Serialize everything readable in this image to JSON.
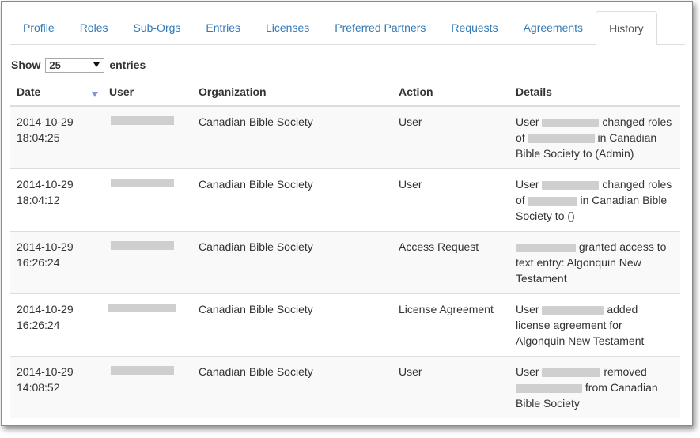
{
  "tabs": [
    {
      "label": "Profile",
      "active": false
    },
    {
      "label": "Roles",
      "active": false
    },
    {
      "label": "Sub-Orgs",
      "active": false
    },
    {
      "label": "Entries",
      "active": false
    },
    {
      "label": "Licenses",
      "active": false
    },
    {
      "label": "Preferred Partners",
      "active": false
    },
    {
      "label": "Requests",
      "active": false
    },
    {
      "label": "Agreements",
      "active": false
    },
    {
      "label": "History",
      "active": true
    }
  ],
  "length_control": {
    "show_label": "Show",
    "selected": "25",
    "entries_label": "entries"
  },
  "table": {
    "columns": [
      "Date",
      "User",
      "Organization",
      "Action",
      "Details"
    ],
    "rows": [
      {
        "date": "2014-10-29",
        "time": "18:04:25",
        "organization": "Canadian Bible Society",
        "action": "User",
        "details": [
          "User ",
          "[r]",
          " changed roles of ",
          "[r]",
          " in Canadian Bible Society to (Admin)"
        ]
      },
      {
        "date": "2014-10-29",
        "time": "18:04:12",
        "organization": "Canadian Bible Society",
        "action": "User",
        "details": [
          "User ",
          "[r]",
          " changed roles of ",
          "[r]",
          " in Canadian Bible Society to ()"
        ]
      },
      {
        "date": "2014-10-29",
        "time": "16:26:24",
        "organization": "Canadian Bible Society",
        "action": "Access Request",
        "details": [
          "[r]",
          " granted access to text entry: Algonquin New Testament"
        ]
      },
      {
        "date": "2014-10-29",
        "time": "16:26:24",
        "organization": "Canadian Bible Society",
        "action": "License Agreement",
        "details": [
          "User ",
          "[r]",
          " added license agreement for Algonquin New Testament"
        ]
      },
      {
        "date": "2014-10-29",
        "time": "14:08:52",
        "organization": "Canadian Bible Society",
        "action": "User",
        "details": [
          "User ",
          "[r]",
          " removed ",
          "[r]",
          " from Canadian Bible Society"
        ]
      }
    ]
  },
  "colors": {
    "link": "#337ab7",
    "sort_indicator": "#8595d4",
    "stripe": "#f9f9f9",
    "border": "#dddddd",
    "redaction": "#cfcfcf"
  }
}
